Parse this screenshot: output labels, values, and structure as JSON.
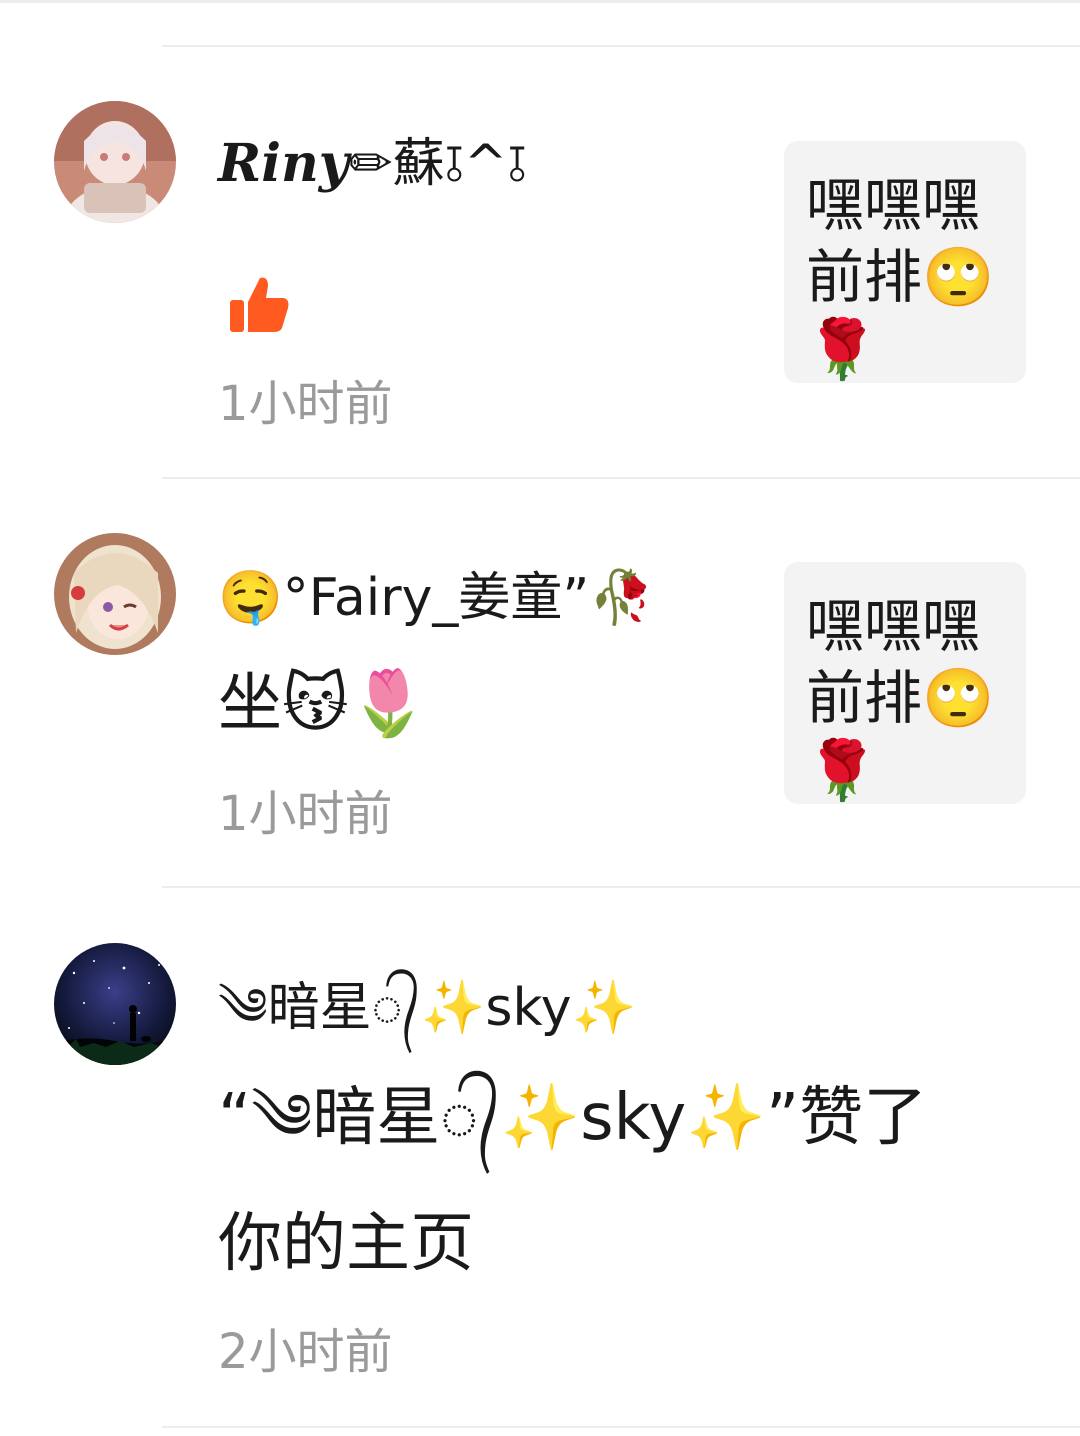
{
  "notifications": [
    {
      "username_a": "Riny",
      "username_b": "✏蘇⫱^⫱",
      "action": "👍",
      "time": "1小时前",
      "quote": "嘿嘿嘿前排🙄🌹",
      "avatar_icon": "anime-girl-avatar-icon"
    },
    {
      "username": "🤤°Fairy_姜童”🥀",
      "action": "坐😽🌷",
      "time": "1小时前",
      "quote": "嘿嘿嘿前排🙄🌹",
      "avatar_icon": "anime-girl-winking-avatar-icon"
    },
    {
      "username": "༄暗星᭄✨sky✨",
      "action_line1": "“༄暗星᭄✨sky✨”赞了",
      "action_line2": "你的主页",
      "time": "2小时前",
      "avatar_icon": "starry-sky-avatar-icon"
    }
  ],
  "colors": {
    "like_icon": "#ff5a1f",
    "time_text": "#9a9a9a",
    "quote_bg": "#f3f3f3",
    "divider": "#ececec"
  }
}
